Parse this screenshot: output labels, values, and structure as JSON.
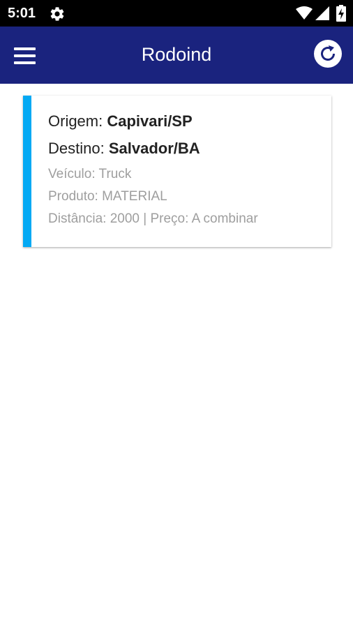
{
  "status_bar": {
    "time": "5:01",
    "icons": [
      "gear-icon",
      "wifi-icon",
      "cell-signal-icon",
      "battery-charging-icon"
    ]
  },
  "app_bar": {
    "title": "Rodoind",
    "menu_icon": "hamburger-menu-icon",
    "refresh_icon": "refresh-icon",
    "background_color": "#1a237e"
  },
  "freight_cards": [
    {
      "accent_color": "#03a9f4",
      "origin_label": "Origem:",
      "origin_value": "Capivari/SP",
      "destination_label": "Destino:",
      "destination_value": "Salvador/BA",
      "vehicle_text": "Veículo: Truck",
      "product_text": "Produto: MATERIAL",
      "distance_price_text": "Distância: 2000 | Preço: A combinar"
    }
  ]
}
